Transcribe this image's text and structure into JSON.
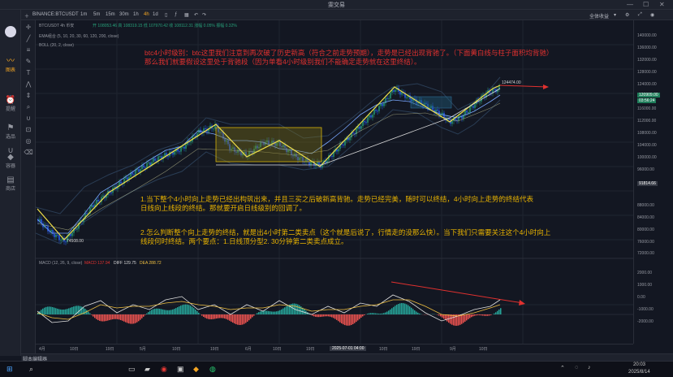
{
  "window": {
    "title": "雯交易",
    "minimize": "—",
    "maximize": "☐",
    "close": "✕"
  },
  "sidebar": {
    "items": [
      {
        "label": "",
        "icon": "avatar-icon"
      },
      {
        "label": "图表",
        "icon": "chart-icon",
        "active": true
      },
      {
        "label": "提醒",
        "icon": "alarm-clock-icon"
      },
      {
        "label": "选品",
        "icon": "flag-icon"
      },
      {
        "label": "",
        "icon": "magnet-icon"
      },
      {
        "label": "容器",
        "icon": "widget-icon"
      },
      {
        "label": "商店",
        "icon": "store-icon"
      }
    ]
  },
  "topbar": {
    "symbol": "BINANCE:BTCUSDT",
    "intervals": [
      "1m",
      "5m",
      "15m",
      "30m",
      "1h",
      "4h",
      "1d"
    ],
    "account": "全体收益"
  },
  "legends": {
    "main": "BTC/USDT  4h  币安",
    "ohlc": "开 108053.46  高 108319.15  低 107970.42  收 108112.31  涨幅 0.05%  振幅 0.32%",
    "ema": "EMA组合 (5, 10, 20, 30, 60, 120, 200, close)",
    "boll": "BOLL (20, 2, close)",
    "macd_name": "MACD (12, 26, 9, close)",
    "macd_val": "MACD 137.94",
    "dif_val": "DIFF 129.75",
    "dea_val": "DEA 288.72"
  },
  "annotations": {
    "header_lines": [
      "btc4小时级别：btc这里我们注意到再次破了历史新高（符合之前走势预期），走势是已经出现背驰了。（下面黄白线与柱子面积均背驰）",
      "那么我们就要假设这里处于背驰段（因为单看4小时级别我们不能确定走势就在这里终结）。"
    ],
    "body_lines": [
      "1.当下整个4小时向上走势已经出构筑出来，并且三买之后破新高背驰。走势已经完美，随时可以终结，4小时向上走势的终结代表",
      "日线向上线段的终结。那就要开启日线级别的回调了。"
    ],
    "body2_lines": [
      "2.怎么判断整个向上走势的终结，就是出4小时第二类卖点（这个就是后说了，行情走的没那么快）。当下我们只需要关注这个4小时向上",
      "线段何时终结。两个要点：1.日线顶分型2.   30分钟第二类卖点成立。"
    ],
    "high_label": "124474.00",
    "low_label": "74508.00"
  },
  "price_axis": {
    "ticks": [
      "140000.00",
      "136000.00",
      "132000.00",
      "128000.00",
      "124000.00",
      "120000.00",
      "116000.00",
      "112000.00",
      "108000.00",
      "104000.00",
      "100000.00",
      "96000.00",
      "88000.00",
      "84000.00",
      "80000.00",
      "76000.00",
      "72000.00"
    ],
    "current_price": "120909.00",
    "countdown": "03:56:24",
    "crosshair_price": "91814.66",
    "macd_ticks": [
      "2000.00",
      "1000.00",
      "0.00",
      "-1000.00",
      "-2000.00"
    ]
  },
  "time_axis": {
    "labels": [
      "4月",
      "10日",
      "19日",
      "5月",
      "10日",
      "19日",
      "6月",
      "10日",
      "19日",
      "10日",
      "19日",
      "9月",
      "10日"
    ],
    "crosshair_time": "2025-07-01   04:00"
  },
  "bottom": {
    "script_editor": "脚本编辑器"
  },
  "taskbar": {
    "time": "20:03",
    "date": "2025/8/14"
  },
  "colors": {
    "note": "#e8b300",
    "note_red": "#e0312f",
    "candle_up": "#27a17a",
    "candle_down": "#2962ff",
    "macd_up": "#26a69a",
    "macd_down": "#ef5350"
  }
}
